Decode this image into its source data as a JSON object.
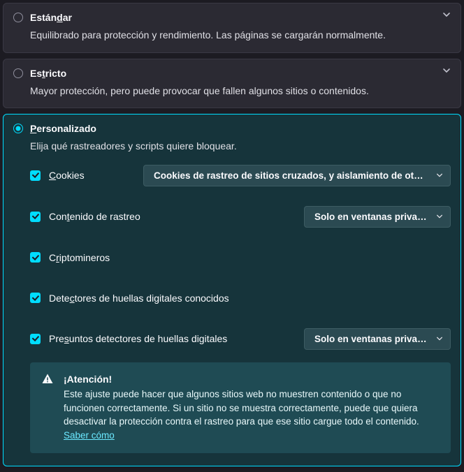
{
  "standard": {
    "title_pre": "Están",
    "title_u": "d",
    "title_post": "ar",
    "desc": "Equilibrado para protección y rendimiento. Las páginas se cargarán normalmente."
  },
  "strict": {
    "title_pre": "Es",
    "title_u": "t",
    "title_post": "ricto",
    "desc": "Mayor protección, pero puede provocar que fallen algunos sitios o contenidos."
  },
  "custom": {
    "title_u": "P",
    "title_post": "ersonalizado",
    "desc": "Elija qué rastreadores y scripts quiere bloquear.",
    "cookies": {
      "label_u": "C",
      "label_post": "ookies",
      "dropdown": "Cookies de rastreo de sitios cruzados, y aislamiento de ot…"
    },
    "tracking": {
      "label_pre": "Con",
      "label_u": "t",
      "label_post": "enido de rastreo",
      "dropdown": "Solo en ventanas privadas"
    },
    "crypto": {
      "label_pre": "C",
      "label_u": "r",
      "label_post": "iptomineros"
    },
    "fingerprint_known": {
      "label_pre": "Dete",
      "label_u": "c",
      "label_post": "tores de huellas digitales conocidos"
    },
    "fingerprint_suspect": {
      "label_pre": "Pre",
      "label_u": "s",
      "label_post": "untos detectores de huellas digitales",
      "dropdown": "Solo en ventanas privadas"
    },
    "warning": {
      "title": "¡Atención!",
      "body": "Este ajuste puede hacer que algunos sitios web no muestren contenido o que no funcionen correctamente. Si un sitio no se muestra correctamente, puede que quiera desactivar la protección contra el rastreo para que ese sitio cargue todo el contenido. ",
      "link": "Saber cómo"
    }
  }
}
